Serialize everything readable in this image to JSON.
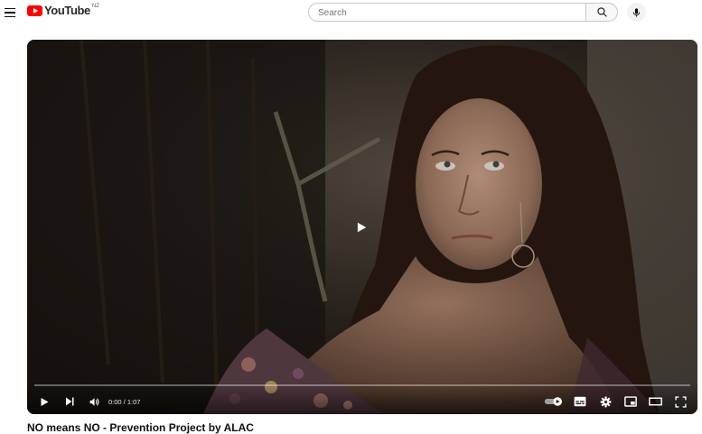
{
  "masthead": {
    "logo_text": "YouTube",
    "country_code": "NZ",
    "search_placeholder": "Search",
    "icons": {
      "menu": "hamburger-menu-icon",
      "search": "search-icon",
      "mic": "microphone-icon"
    }
  },
  "player": {
    "time_display": "0:00 / 1:07",
    "progress_fraction": 0.0,
    "autoplay_on": true,
    "controls": [
      "play-icon",
      "next-icon",
      "volume-icon",
      "autoplay-toggle",
      "subtitles-icon",
      "settings-gear-icon",
      "miniplayer-icon",
      "theater-mode-icon",
      "fullscreen-icon"
    ]
  },
  "video": {
    "title": "NO means NO - Prevention Project by ALAC"
  },
  "colors": {
    "brand_red": "#ff0000",
    "text": "#0f0f0f"
  }
}
